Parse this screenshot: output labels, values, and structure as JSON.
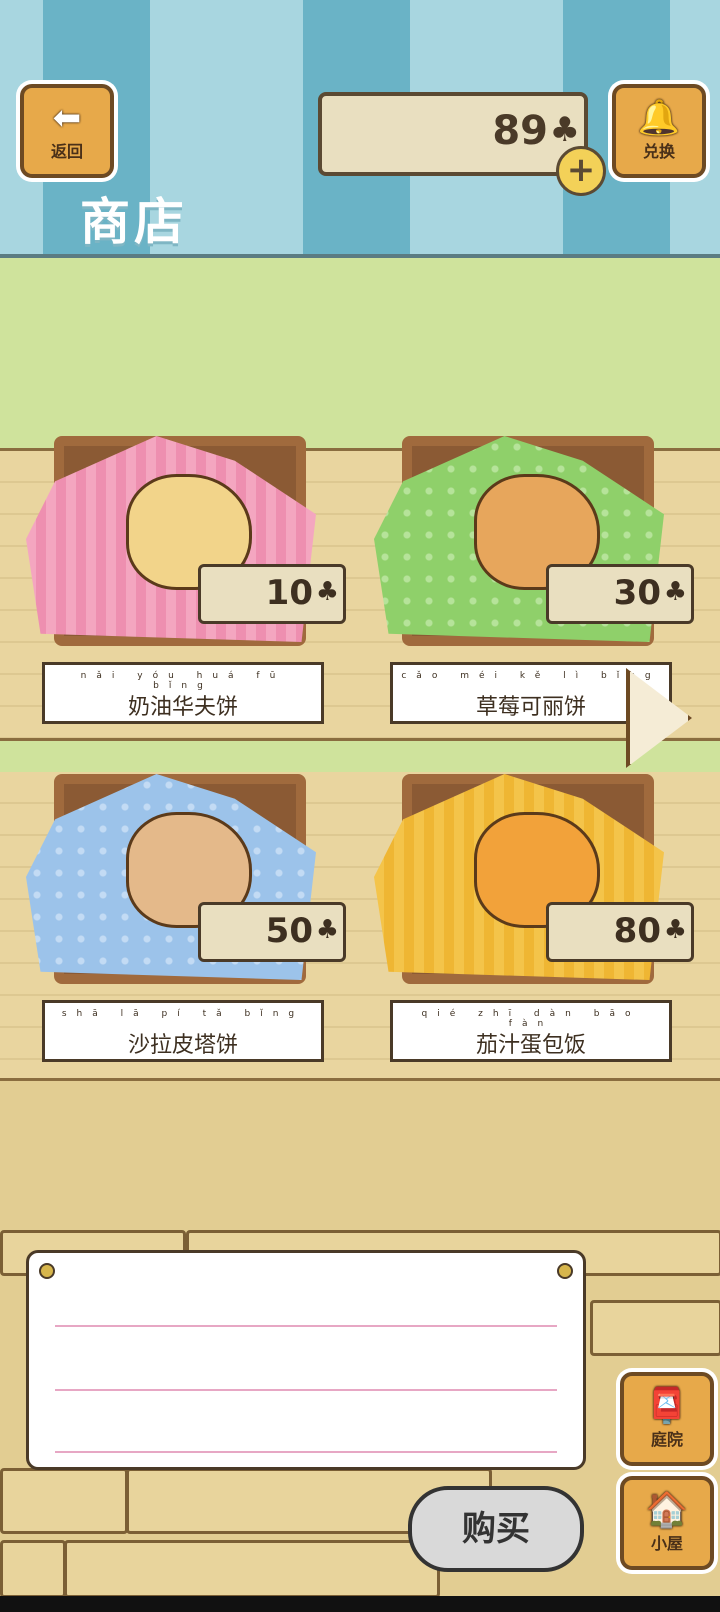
{
  "header": {
    "back_label": "返回",
    "back_icon": "left-arrow-icon",
    "title": "商店",
    "clover_count": "89",
    "clover_symbol": "♣",
    "plus_symbol": "+",
    "exchange_label": "兑换",
    "exchange_icon": "bell-icon"
  },
  "items": [
    {
      "name": "奶油华夫饼",
      "pinyin": "nǎi yóu huá fū bǐng",
      "price": "10",
      "cloth_color": "#f4a6c0",
      "food_color": "#f2d48a"
    },
    {
      "name": "草莓可丽饼",
      "pinyin": "cǎo méi kě lì bǐng",
      "price": "30",
      "cloth_color": "#8fd06a",
      "food_color": "#e7a65c"
    },
    {
      "name": "沙拉皮塔饼",
      "pinyin": "shā lā pí tǎ bǐng",
      "price": "50",
      "cloth_color": "#9cc3ea",
      "food_color": "#e4b98a"
    },
    {
      "name": "茄汁蛋包饭",
      "pinyin": "qié zhī dàn bāo fàn",
      "price": "80",
      "cloth_color": "#f4c44a",
      "food_color": "#f2a23a"
    }
  ],
  "next_page_icon": "right-arrow-icon",
  "buy_label": "购买",
  "nav": {
    "yard_label": "庭院",
    "yard_icon": "mailbox-icon",
    "house_label": "小屋",
    "house_icon": "house-icon"
  }
}
